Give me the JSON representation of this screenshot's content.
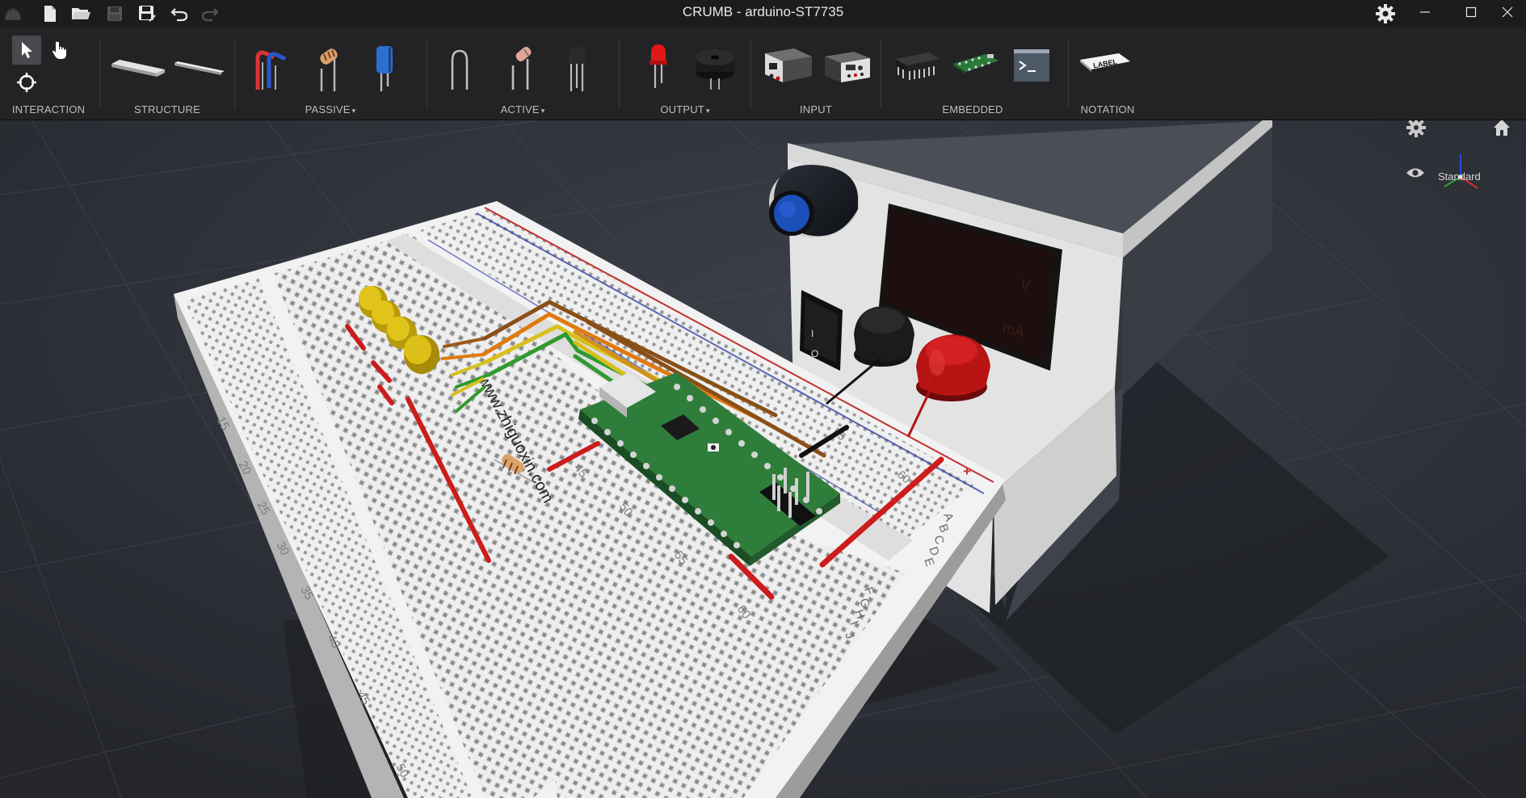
{
  "window": {
    "title": "CRUMB - arduino-ST7735"
  },
  "titlebar_icons": [
    "app-logo-icon",
    "new-file-icon",
    "open-folder-icon",
    "save-icon",
    "save-as-icon",
    "undo-icon",
    "redo-icon"
  ],
  "toolbar": {
    "groups": [
      {
        "id": "interaction",
        "label": "INTERACTION"
      },
      {
        "id": "structure",
        "label": "STRUCTURE"
      },
      {
        "id": "passive",
        "label": "PASSIVE",
        "dropdown": true
      },
      {
        "id": "active",
        "label": "ACTIVE",
        "dropdown": true
      },
      {
        "id": "output",
        "label": "OUTPUT",
        "dropdown": true
      },
      {
        "id": "input",
        "label": "INPUT"
      },
      {
        "id": "embedded",
        "label": "EMBEDDED"
      },
      {
        "id": "notation",
        "label": "NOTATION"
      }
    ],
    "notation_label_text": "LABEL",
    "dropdown_caret": "▾"
  },
  "viewport": {
    "view_mode": "Standard",
    "watermark": "www.zhiguoxin.com",
    "power_supply": {
      "voltage_unit": "V",
      "current_unit": "mA",
      "switch_on": "I",
      "switch_off": "O"
    },
    "breadboard_numbers_left": [
      "15",
      "20",
      "25",
      "30",
      "35",
      "40",
      "45",
      "50"
    ],
    "breadboard_numbers_mid": [
      "45",
      "50",
      "55",
      "60"
    ],
    "breadboard_numbers_right": [
      "55",
      "60"
    ],
    "breadboard_rows_right": [
      "A",
      "B",
      "C",
      "D",
      "E"
    ],
    "breadboard_rows_right2": [
      "F",
      "G",
      "H",
      "I",
      "J"
    ],
    "rail_sign": "+"
  },
  "colors": {
    "titlebar": "#1c1c1c",
    "toolbar": "#232325",
    "viewport_bg": "#2c2f36",
    "accent_red": "#d62020",
    "board_green": "#2f7d3a"
  }
}
